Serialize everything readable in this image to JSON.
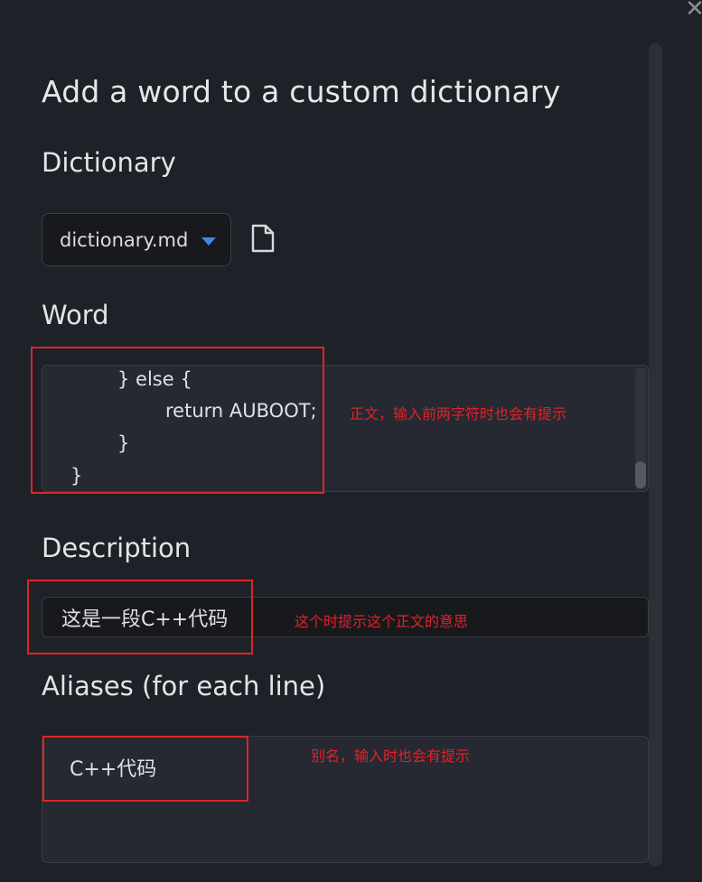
{
  "dialog": {
    "close_icon": "close-icon",
    "title": "Add a word to a custom dictionary"
  },
  "dictionary": {
    "heading": "Dictionary",
    "selected": "dictionary.md",
    "caret_color": "#4a84e6",
    "file_icon": "file-icon"
  },
  "word": {
    "heading": "Word",
    "lines": [
      "} else {",
      "return AUBOOT;",
      "}",
      "}"
    ]
  },
  "description": {
    "heading": "Description",
    "value": "这是一段C++代码"
  },
  "aliases": {
    "heading": "Aliases (for each line)",
    "value": "C++代码"
  },
  "annotations": {
    "word_note": "正文，输入前两字符时也会有提示",
    "description_note": "这个时提示这个正文的意思",
    "alias_note": "别名，输入时也会有提示",
    "highlight_color": "#e0232a"
  }
}
